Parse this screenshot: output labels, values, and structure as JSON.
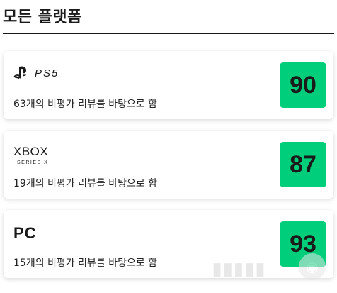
{
  "section": {
    "title": "모든 플랫폼"
  },
  "platforms": [
    {
      "logo_text": "PS5",
      "logo_icon": "playstation-icon",
      "review_text": "63개의 비평가 리뷰를 바탕으로 함",
      "score": "90"
    },
    {
      "logo_text": "XBOX",
      "logo_sub": "SERIES X",
      "review_text": "19개의 비평가 리뷰를 바탕으로 함",
      "score": "87"
    },
    {
      "logo_text": "PC",
      "review_text": "15개의 비평가 리뷰를 바탕으로 함",
      "score": "93"
    }
  ],
  "colors": {
    "score_bg": "#00ce7a",
    "text": "#1a1a1a"
  }
}
